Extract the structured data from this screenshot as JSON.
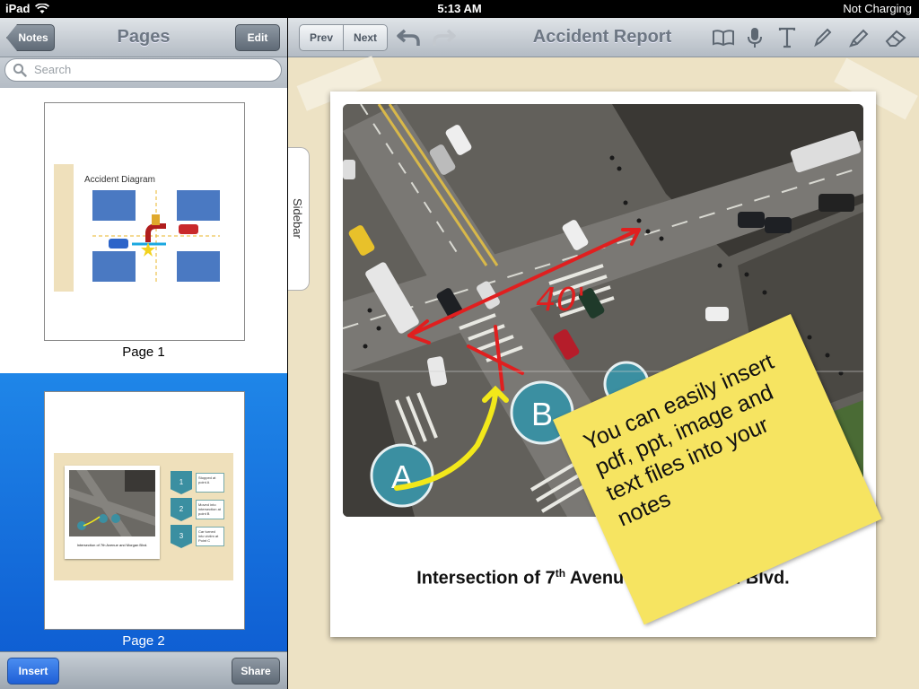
{
  "status": {
    "device": "iPad",
    "time": "5:13 AM",
    "battery": "Not Charging"
  },
  "left": {
    "title": "Pages",
    "back_label": "Notes",
    "edit_label": "Edit",
    "search_placeholder": "Search",
    "pages": [
      {
        "label": "Page 1",
        "thumb_title": "Accident Diagram",
        "selected": false
      },
      {
        "label": "Page 2",
        "selected": true,
        "thumb_caption": "Intersection of 7th Avenue and Morgan Blvd.",
        "steps": [
          {
            "num": "1",
            "text": "Stopped at point A"
          },
          {
            "num": "2",
            "text": "Moved into intersection at point B"
          },
          {
            "num": "3",
            "text": "Car turned into victim at Point C"
          }
        ]
      }
    ],
    "insert_label": "Insert",
    "share_label": "Share"
  },
  "right": {
    "title": "Accident Report",
    "prev_label": "Prev",
    "next_label": "Next",
    "sidebar_label": "Sidebar",
    "tool_icons": [
      "undo-icon",
      "redo-icon",
      "book-icon",
      "microphone-icon",
      "text-tool-icon",
      "pen-icon",
      "highlighter-icon",
      "eraser-icon"
    ],
    "markers": {
      "a": "A",
      "b": "B",
      "distance": "40'"
    },
    "caption_pre": "Intersection of 7",
    "caption_sup": "th",
    "caption_post": " Avenue and Morgan Blvd.",
    "sticky_lines": [
      "You can easily insert",
      "pdf, ppt, image and",
      "text files into your",
      "notes"
    ]
  },
  "colors": {
    "selected_blue": "#1473e6",
    "sticky_yellow": "#f6e461",
    "marker_teal": "#3b8fa1",
    "ink_red": "#e01f1f",
    "ink_yellow": "#f2e81a"
  }
}
